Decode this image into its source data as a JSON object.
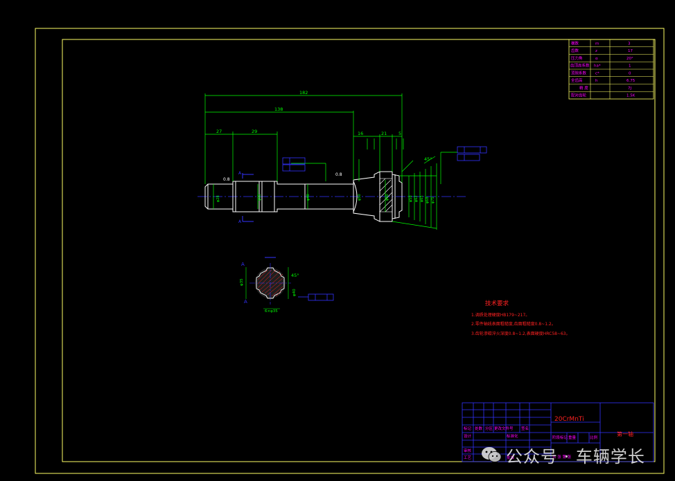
{
  "colors": {
    "frame": "#ffff66",
    "geometry": "#ffffff",
    "dimension": "#00ff00",
    "annotation": "#3333ff",
    "note_text": "#ff2222",
    "table_text": "#ff00ff",
    "table_line": "#ffff66",
    "title_line": "#3333ff"
  },
  "dimensions": {
    "overall_length": "182",
    "length_138": "138",
    "length_27": "27",
    "length_29": "29",
    "length_16": "16",
    "length_21": "21",
    "length_5": "5",
    "roughness_left": "0.8",
    "roughness_mid": "0.8",
    "angle_right": "45°",
    "angle_section": "45°",
    "section_label": "A",
    "section_view_label": "A"
  },
  "param_table": {
    "rows": [
      [
        "模数",
        "m",
        "3"
      ],
      [
        "齿数",
        "z",
        "17"
      ],
      [
        "压力角",
        "α",
        "20°"
      ],
      [
        "齿顶高系数",
        "ha*",
        "1"
      ],
      [
        "顶隙系数",
        "c*",
        "0"
      ],
      [
        "全齿高",
        "h",
        "6.75"
      ],
      [
        "精 度",
        "",
        "7J"
      ],
      [
        "配对齿轮",
        "",
        "1.5K"
      ]
    ]
  },
  "tech_requirements": {
    "title": "技术要求",
    "items": [
      "1.调质处理硬度HB179~217。",
      "2.零件轴线表面粗糙度,齿面粗糙度0.8~1.2。",
      "3.齿轮渗碳淬火深度0.8~1.2,表面硬度HRC58~63。"
    ]
  },
  "title_block": {
    "material": "20CrMnTi",
    "part_name": "第一轴",
    "header_cells": [
      "标记",
      "处数",
      "分区",
      "更改文件号",
      "签名"
    ],
    "row_design": "设计",
    "row_std": "标准化",
    "row_review": "审核",
    "row_process": "工艺",
    "row_approve": "批准",
    "stage_label": "阶段标记",
    "weight_label": "重量",
    "scale_label": "比例",
    "sheet_label": "共 张 第 张"
  },
  "watermark": {
    "text": "公众号 · 车辆学长"
  }
}
